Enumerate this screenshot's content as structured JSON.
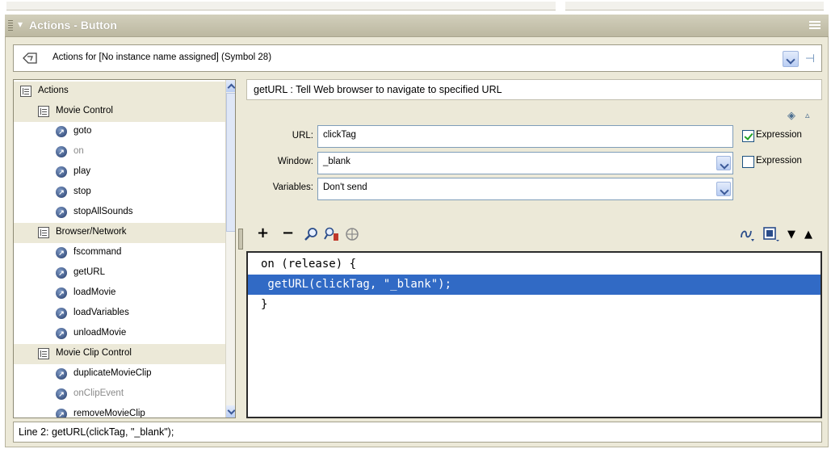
{
  "panel": {
    "title": "Actions - Button"
  },
  "actions_for": {
    "label": "Actions for [No instance name assigned] (Symbol 28)"
  },
  "tree": {
    "items": [
      {
        "label": "Actions",
        "kind": "category",
        "level": 0
      },
      {
        "label": "Movie Control",
        "kind": "category",
        "level": 1
      },
      {
        "label": "goto",
        "kind": "action",
        "level": 2
      },
      {
        "label": "on",
        "kind": "action",
        "level": 2,
        "dim": true
      },
      {
        "label": "play",
        "kind": "action",
        "level": 2
      },
      {
        "label": "stop",
        "kind": "action",
        "level": 2
      },
      {
        "label": "stopAllSounds",
        "kind": "action",
        "level": 2
      },
      {
        "label": "Browser/Network",
        "kind": "category",
        "level": 1
      },
      {
        "label": "fscommand",
        "kind": "action",
        "level": 2
      },
      {
        "label": "getURL",
        "kind": "action",
        "level": 2
      },
      {
        "label": "loadMovie",
        "kind": "action",
        "level": 2
      },
      {
        "label": "loadVariables",
        "kind": "action",
        "level": 2
      },
      {
        "label": "unloadMovie",
        "kind": "action",
        "level": 2
      },
      {
        "label": "Movie Clip Control",
        "kind": "category",
        "level": 1
      },
      {
        "label": "duplicateMovieClip",
        "kind": "action",
        "level": 2
      },
      {
        "label": "onClipEvent",
        "kind": "action",
        "level": 2,
        "dim": true
      },
      {
        "label": "removeMovieClip",
        "kind": "action",
        "level": 2
      }
    ]
  },
  "description": "getURL : Tell Web browser to navigate to specified URL",
  "params": {
    "url_label": "URL:",
    "url_value": "clickTag",
    "url_expression_label": "Expression",
    "url_expression_checked": true,
    "window_label": "Window:",
    "window_value": "_blank",
    "window_expression_label": "Expression",
    "window_expression_checked": false,
    "variables_label": "Variables:",
    "variables_value": "Don't send"
  },
  "toolbar": {
    "add": "+",
    "remove": "−"
  },
  "code": {
    "lines": [
      "on (release) {",
      " getURL(clickTag, \"_blank\");",
      "}"
    ],
    "selected_line": 2
  },
  "status": {
    "text": "Line 2: getURL(clickTag, \"_blank\");"
  },
  "colors": {
    "selection": "#316ac5",
    "panel_bg": "#ece9d8",
    "title_bar": "#bcb8a1"
  }
}
